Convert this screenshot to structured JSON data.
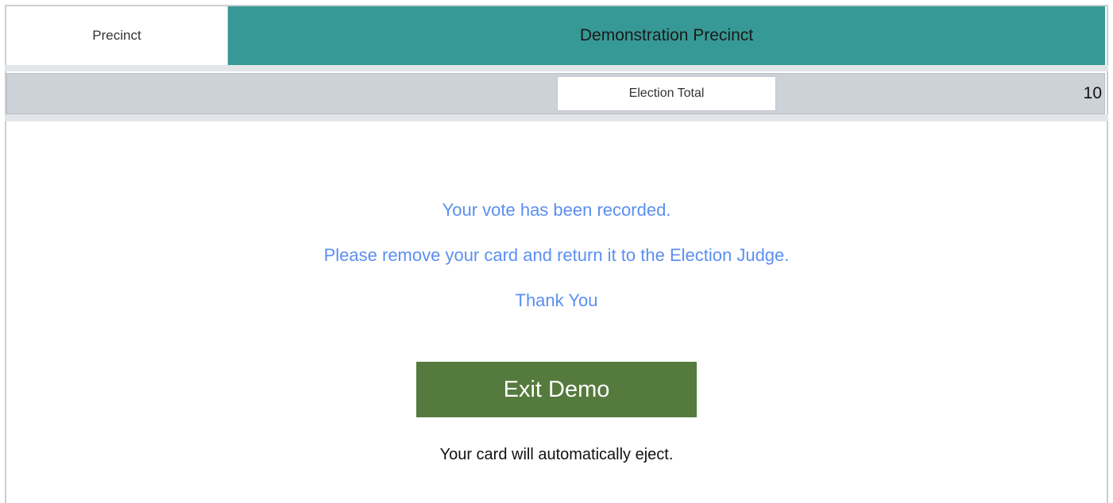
{
  "header": {
    "precinct_label": "Precinct",
    "precinct_name": "Demonstration Precinct"
  },
  "totals": {
    "label": "Election Total",
    "value": "10"
  },
  "confirmation": {
    "line1": "Your vote has been recorded.",
    "line2": "Please remove your card and return it to the Election Judge.",
    "line3": "Thank You"
  },
  "actions": {
    "exit_label": "Exit Demo"
  },
  "footer": {
    "eject_note": "Your card will automatically eject."
  },
  "colors": {
    "header_accent": "#379995",
    "totals_bar": "#ccd2d7",
    "message_text": "#5b8ff0",
    "exit_button": "#557a3d"
  }
}
